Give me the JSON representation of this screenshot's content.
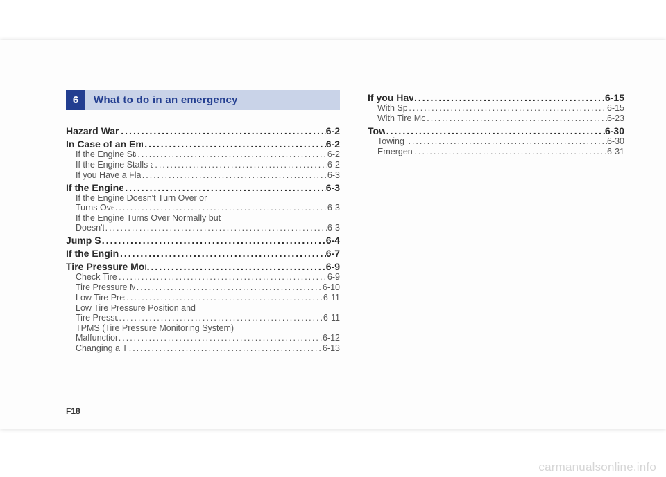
{
  "section": {
    "number": "6",
    "title": "What to do in an emergency"
  },
  "toc_left": [
    {
      "type": "main",
      "title": "Hazard Warning Flasher",
      "page": "6-2"
    },
    {
      "type": "main",
      "title": "In Case of an Emergency While Driving",
      "page": "6-2"
    },
    {
      "type": "sub",
      "title": "If the Engine Stalls While Driving",
      "page": "6-2"
    },
    {
      "type": "sub",
      "title": "If the Engine Stalls at a Crossroad or Crossing",
      "page": "6-2"
    },
    {
      "type": "sub",
      "title": "If you Have a Flat Tire While Driving",
      "page": "6-3"
    },
    {
      "type": "main",
      "title": "If the Engine Will Not Start",
      "page": "6-3"
    },
    {
      "type": "sub-wrap1",
      "title": "If the Engine Doesn't Turn Over or"
    },
    {
      "type": "sub-wrap2",
      "title": "Turns Over Slowly",
      "page": "6-3"
    },
    {
      "type": "sub-wrap1",
      "title": "If the Engine Turns Over Normally but"
    },
    {
      "type": "sub-wrap2",
      "title": "Doesn't Start",
      "page": "6-3"
    },
    {
      "type": "main",
      "title": "Jump Starting",
      "page": "6-4"
    },
    {
      "type": "main",
      "title": "If the Engine Overheats",
      "page": "6-7"
    },
    {
      "type": "main",
      "title": "Tire Pressure Monitoring System (TPMS)",
      "page": "6-9"
    },
    {
      "type": "sub",
      "title": "Check Tire Pressure",
      "page": "6-9"
    },
    {
      "type": "sub",
      "title": "Tire Pressure Monitoring System",
      "page": "6-10"
    },
    {
      "type": "sub",
      "title": "Low Tire Pressure Telltale",
      "page": "6-11"
    },
    {
      "type": "sub-wrap1",
      "title": "Low Tire Pressure Position and"
    },
    {
      "type": "sub-wrap2",
      "title": "Tire Pressure Telltale",
      "page": "6-11"
    },
    {
      "type": "sub-wrap1",
      "title": "TPMS (Tire Pressure Monitoring System)"
    },
    {
      "type": "sub-wrap2",
      "title": "Malfunction Indicator",
      "page": "6-12"
    },
    {
      "type": "sub",
      "title": "Changing a Tire with TPMS",
      "page": "6-13"
    }
  ],
  "toc_right": [
    {
      "type": "main",
      "title": "If you Have a Flat Tire",
      "page": "6-15"
    },
    {
      "type": "sub",
      "title": "With Spare Tire",
      "page": "6-15"
    },
    {
      "type": "sub",
      "title": "With Tire Mobility Kit (TMK)",
      "page": "6-23"
    },
    {
      "type": "main",
      "title": "Towing",
      "page": "6-30"
    },
    {
      "type": "sub",
      "title": "Towing Service",
      "page": "6-30"
    },
    {
      "type": "sub",
      "title": "Emergency Towing",
      "page": "6-31"
    }
  ],
  "page_number": "F18",
  "watermark": "carmanualsonline.info",
  "leader": "......................................................................................................."
}
